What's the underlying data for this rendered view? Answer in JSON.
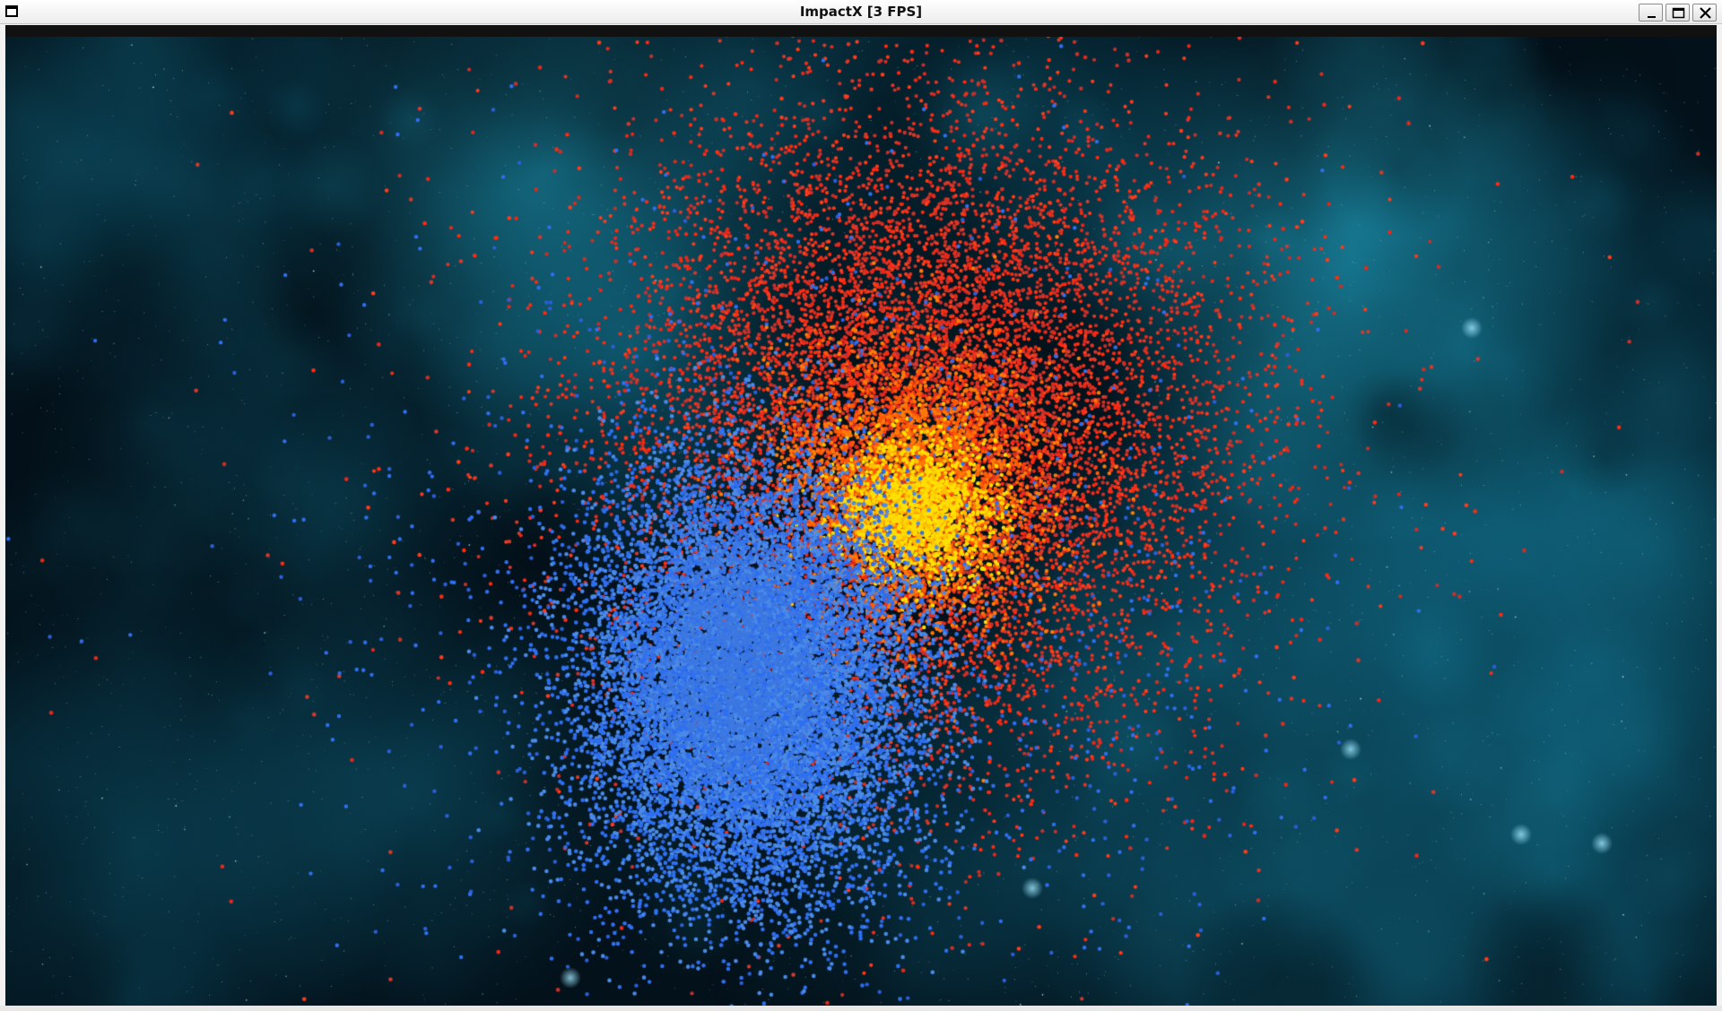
{
  "window": {
    "title": "ImpactX [3 FPS]",
    "controls": {
      "minimize_icon": "minimize-icon",
      "maximize_icon": "maximize-icon",
      "close_icon": "close-icon",
      "menu_icon": "window-menu-icon"
    }
  },
  "scene": {
    "description_icon": "particle-simulation",
    "colors": {
      "background_dark": "#03111a",
      "nebula": "#1ab4d8",
      "particle_red": "#ff2a10",
      "particle_red_dim": "#d8382a",
      "particle_orange": "#ff7a08",
      "particle_yellow": "#ffe000",
      "particle_blue": "#2f6ff0",
      "particle_blue_light": "#4a8ae8"
    }
  }
}
